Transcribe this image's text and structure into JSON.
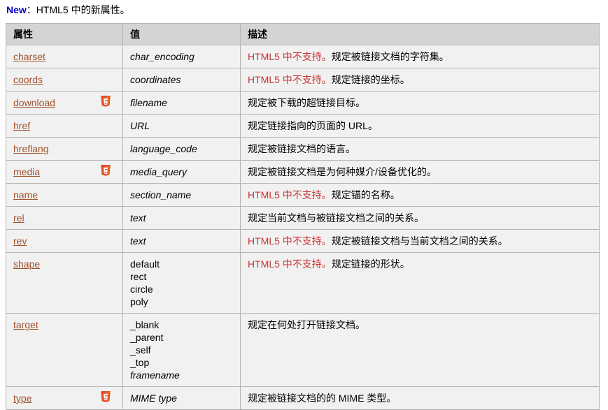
{
  "note": {
    "label": "New",
    "text": "：HTML5 中的新属性。"
  },
  "colors": {
    "new_label": "#0000cc",
    "link": "#a0522d",
    "not_supported": "#cc3333",
    "header_bg": "#d4d4d4",
    "cell_bg": "#f1f1f1",
    "border": "#b5b5b5",
    "html5_badge_outer": "#e44d26",
    "html5_badge_inner": "#f16529"
  },
  "table": {
    "headers": {
      "attribute": "属性",
      "value": "值",
      "description": "描述"
    },
    "rows": [
      {
        "attribute": "charset",
        "badge": false,
        "value": "char_encoding",
        "value_italic": true,
        "value_list": null,
        "not_supported": "HTML5 中不支持。",
        "description": "规定被链接文档的字符集。"
      },
      {
        "attribute": "coords",
        "badge": false,
        "value": "coordinates",
        "value_italic": true,
        "value_list": null,
        "not_supported": "HTML5 中不支持。",
        "description": "规定链接的坐标。"
      },
      {
        "attribute": "download",
        "badge": true,
        "value": "filename",
        "value_italic": true,
        "value_list": null,
        "not_supported": "",
        "description": "规定被下载的超链接目标。"
      },
      {
        "attribute": "href",
        "badge": false,
        "value": "URL",
        "value_italic": true,
        "value_list": null,
        "not_supported": "",
        "description": "规定链接指向的页面的 URL。"
      },
      {
        "attribute": "hreflang",
        "badge": false,
        "value": "language_code",
        "value_italic": true,
        "value_list": null,
        "not_supported": "",
        "description": "规定被链接文档的语言。"
      },
      {
        "attribute": "media",
        "badge": true,
        "value": "media_query",
        "value_italic": true,
        "value_list": null,
        "not_supported": "",
        "description": "规定被链接文档是为何种媒介/设备优化的。"
      },
      {
        "attribute": "name",
        "badge": false,
        "value": "section_name",
        "value_italic": true,
        "value_list": null,
        "not_supported": "HTML5 中不支持。",
        "description": "规定锚的名称。"
      },
      {
        "attribute": "rel",
        "badge": false,
        "value": "text",
        "value_italic": true,
        "value_list": null,
        "not_supported": "",
        "description": "规定当前文档与被链接文档之间的关系。"
      },
      {
        "attribute": "rev",
        "badge": false,
        "value": "text",
        "value_italic": true,
        "value_list": null,
        "not_supported": "HTML5 中不支持。",
        "description": "规定被链接文档与当前文档之间的关系。"
      },
      {
        "attribute": "shape",
        "badge": false,
        "value": null,
        "value_italic": false,
        "value_list": [
          {
            "text": "default",
            "italic": false
          },
          {
            "text": "rect",
            "italic": false
          },
          {
            "text": "circle",
            "italic": false
          },
          {
            "text": "poly",
            "italic": false
          }
        ],
        "not_supported": "HTML5 中不支持。",
        "description": "规定链接的形状。"
      },
      {
        "attribute": "target",
        "badge": false,
        "value": null,
        "value_italic": false,
        "value_list": [
          {
            "text": "_blank",
            "italic": false
          },
          {
            "text": "_parent",
            "italic": false
          },
          {
            "text": "_self",
            "italic": false
          },
          {
            "text": "_top",
            "italic": false
          },
          {
            "text": "framename",
            "italic": true
          }
        ],
        "not_supported": "",
        "description": "规定在何处打开链接文档。"
      },
      {
        "attribute": "type",
        "badge": true,
        "value": "MIME type",
        "value_italic": true,
        "value_list": null,
        "not_supported": "",
        "description": "规定被链接文档的的 MIME 类型。"
      }
    ]
  }
}
